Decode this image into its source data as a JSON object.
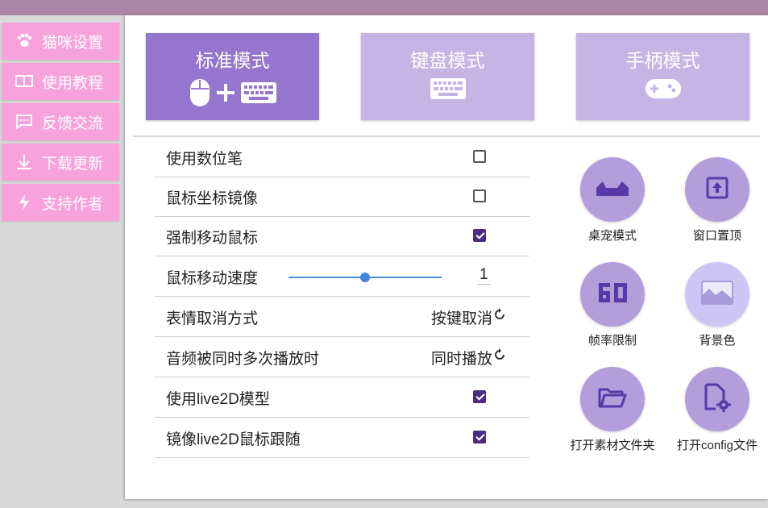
{
  "colors": {
    "accent_active": "#9575cd",
    "accent_inactive": "#c5b5e4",
    "sidebar_bg": "#f8a2dc",
    "tool_circle": "#b39ddb",
    "tool_circle_light": "#cdc6f5",
    "tool_icon": "#5a38a8",
    "check_color": "#4b2b86"
  },
  "sidebar": {
    "items": [
      {
        "label": "猫咪设置",
        "icon": "paw-icon"
      },
      {
        "label": "使用教程",
        "icon": "book-icon"
      },
      {
        "label": "反馈交流",
        "icon": "chat-icon"
      },
      {
        "label": "下载更新",
        "icon": "download-icon"
      },
      {
        "label": "支持作者",
        "icon": "lightning-icon"
      }
    ]
  },
  "modes": [
    {
      "label": "标准模式",
      "active": true,
      "icons": [
        "mouse-icon",
        "plus-icon",
        "keyboard-icon"
      ]
    },
    {
      "label": "键盘模式",
      "active": false,
      "icons": [
        "keyboard-icon"
      ]
    },
    {
      "label": "手柄模式",
      "active": false,
      "icons": [
        "gamepad-icon"
      ]
    }
  ],
  "settings": [
    {
      "label": "使用数位笔",
      "type": "checkbox",
      "checked": false
    },
    {
      "label": "鼠标坐标镜像",
      "type": "checkbox",
      "checked": false
    },
    {
      "label": "强制移动鼠标",
      "type": "checkbox",
      "checked": true
    },
    {
      "label": "鼠标移动速度",
      "type": "slider",
      "value": "1",
      "slider_fraction": 0.5
    },
    {
      "label": "表情取消方式",
      "type": "cycle",
      "value": "按键取消"
    },
    {
      "label": "音频被同时多次播放时",
      "type": "cycle",
      "value": "同时播放"
    },
    {
      "label": "使用live2D模型",
      "type": "checkbox",
      "checked": true
    },
    {
      "label": "镜像live2D鼠标跟随",
      "type": "checkbox",
      "checked": true
    }
  ],
  "tools": [
    {
      "label": "桌宠模式",
      "icon": "cat-ears-icon"
    },
    {
      "label": "窗口置顶",
      "icon": "pin-top-icon"
    },
    {
      "label": "帧率限制",
      "icon": "fps-60-icon"
    },
    {
      "label": "背景色",
      "icon": "image-icon"
    },
    {
      "label": "打开素材文件夹",
      "icon": "folder-open-icon"
    },
    {
      "label": "打开config文件",
      "icon": "file-settings-icon"
    }
  ]
}
